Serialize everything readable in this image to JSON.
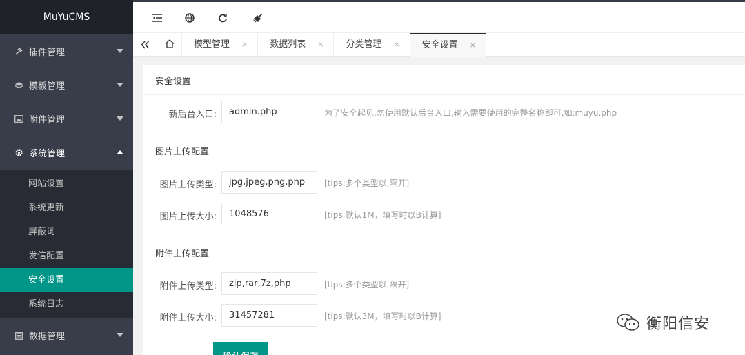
{
  "app": {
    "title": "MuYuCMS"
  },
  "sidebar": {
    "items": [
      {
        "label": "插件管理",
        "icon": "plugin-icon"
      },
      {
        "label": "模板管理",
        "icon": "layers-icon"
      },
      {
        "label": "附件管理",
        "icon": "image-icon"
      },
      {
        "label": "系统管理",
        "icon": "gear-icon"
      },
      {
        "label": "数据管理",
        "icon": "clipboard-icon"
      }
    ],
    "subitems": [
      "网站设置",
      "系统更新",
      "屏蔽词",
      "发信配置",
      "安全设置",
      "系统日志"
    ]
  },
  "toolbar": {
    "icons": [
      "menu-collapse-icon",
      "globe-icon",
      "refresh-icon",
      "broom-icon"
    ]
  },
  "tabs": {
    "home_icon": "home-icon",
    "items": [
      "模型管理",
      "数据列表",
      "分类管理",
      "安全设置"
    ],
    "close": "×",
    "active": "安全设置"
  },
  "sections": {
    "security": {
      "title": "安全设置",
      "entry_label": "新后台入口:",
      "entry_value": "admin.php",
      "entry_tip": "为了安全起见,勿使用默认后台入口,输入需要使用的完整名称即可,如:muyu.php"
    },
    "image_upload": {
      "title": "图片上传配置",
      "type_label": "图片上传类型:",
      "type_value": "jpg,jpeg,png,php",
      "type_tip": "[tips:多个类型以,隔开]",
      "size_label": "图片上传大小:",
      "size_value": "1048576",
      "size_tip": "[tips:默认1M，填写时以B计算]"
    },
    "attach_upload": {
      "title": "附件上传配置",
      "type_label": "附件上传类型:",
      "type_value": "zip,rar,7z,php",
      "type_tip": "[tips:多个类型以,隔开]",
      "size_label": "附件上传大小:",
      "size_value": "31457281",
      "size_tip": "[tips:默认3M，填写时以B计算]"
    }
  },
  "actions": {
    "save_label": "确认保存"
  },
  "watermark": {
    "text": "衡阳信安",
    "icon": "wechat-icon"
  },
  "colors": {
    "accent": "#009688",
    "sidebar": "#393d49",
    "sidebar_dark": "#282b33"
  }
}
